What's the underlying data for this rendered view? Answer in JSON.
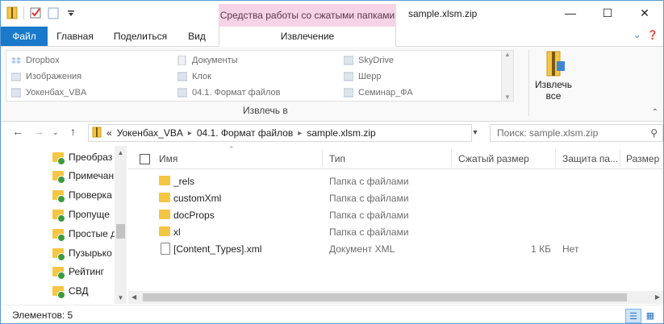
{
  "window": {
    "title": "sample.xlsm.zip",
    "context_tab_header": "Средства работы со сжатыми папками"
  },
  "ribbon_tabs": [
    "Файл",
    "Главная",
    "Поделиться",
    "Вид",
    "Извлечение"
  ],
  "extract_to": {
    "group_label": "Извлечь в",
    "items": [
      [
        "Dropbox",
        "Документы",
        "SkyDrive"
      ],
      [
        "Изображения",
        "Клок",
        "Шерр"
      ],
      [
        "Уокенбах_VBA",
        "04.1. Формат файлов",
        "Семинар_ФА"
      ]
    ]
  },
  "extract_all_label": "Извлечь все",
  "address": {
    "prefix": "«",
    "crumbs": [
      "Уокенбах_VBA",
      "04.1. Формат файлов",
      "sample.xlsm.zip"
    ]
  },
  "search": {
    "placeholder": "Поиск: sample.xlsm.zip"
  },
  "nav_items": [
    "Преобраз",
    "Примечан",
    "Проверка",
    "Пропуще",
    "Простые д",
    "Пузырько",
    "Рейтинг",
    "СВД"
  ],
  "columns": {
    "name": "Имя",
    "type": "Тип",
    "compressed": "Сжатый размер",
    "protect": "Защита па...",
    "size": "Размер"
  },
  "files": [
    {
      "name": "_rels",
      "type": "Папка с файлами",
      "csize": "",
      "prot": "",
      "kind": "folder"
    },
    {
      "name": "customXml",
      "type": "Папка с файлами",
      "csize": "",
      "prot": "",
      "kind": "folder"
    },
    {
      "name": "docProps",
      "type": "Папка с файлами",
      "csize": "",
      "prot": "",
      "kind": "folder"
    },
    {
      "name": "xl",
      "type": "Папка с файлами",
      "csize": "",
      "prot": "",
      "kind": "folder"
    },
    {
      "name": "[Content_Types].xml",
      "type": "Документ XML",
      "csize": "1 КБ",
      "prot": "Нет",
      "kind": "file"
    }
  ],
  "status": {
    "items_count": "Элементов: 5"
  },
  "colors": {
    "file_tab": "#1979ca",
    "context_tab": "#f6d3e7",
    "folder": "#f4c644"
  }
}
